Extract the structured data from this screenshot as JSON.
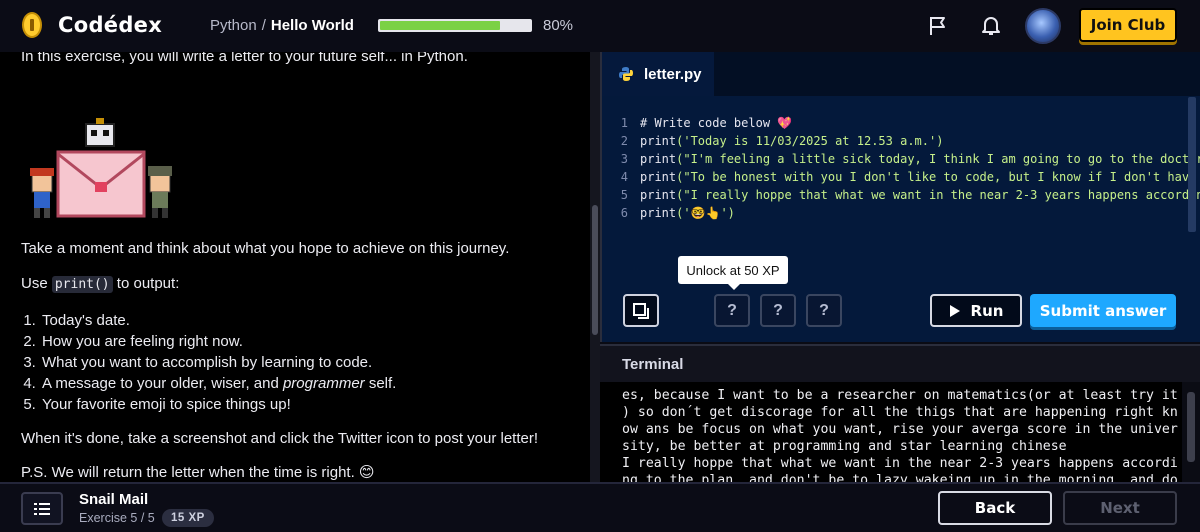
{
  "brand": {
    "name": "Codédex"
  },
  "breadcrumb": {
    "course": "Python",
    "separator": "/",
    "lesson": "Hello World"
  },
  "progress": {
    "percent": 80,
    "label": "80%"
  },
  "header": {
    "join_label": "Join Club",
    "icons": [
      "flag-icon",
      "bell-icon"
    ]
  },
  "lesson": {
    "intro": "In this exercise, you will write a letter to your future self... in Python.",
    "reflect": "Take a moment and think about what you hope to achieve on this journey.",
    "use_prefix": "Use ",
    "use_code": "print()",
    "use_suffix": " to output:",
    "steps": [
      "Today's date.",
      "How you are feeling right now.",
      "What you want to accomplish by learning to code.",
      "A message to your older, wiser, and ",
      "Your favorite emoji to spice things up!"
    ],
    "step4_em": "programmer",
    "step4_end": " self.",
    "done": "When it's done, take a screenshot and click the Twitter icon to post your letter!",
    "ps": "P.S. We will return the letter when the time is right. 😊"
  },
  "editor": {
    "tab_name": "letter.py",
    "lines": [
      {
        "n": "1",
        "pre": "",
        "text": "# Write code below 💖",
        "kind": "comment"
      },
      {
        "n": "2",
        "pre": "print",
        "text": "('Today is 11/03/2025 at 12.53 a.m.')",
        "kind": "call"
      },
      {
        "n": "3",
        "pre": "print",
        "text": "(\"I'm feeling a little sick today, I think I am going to go to the doctor",
        "kind": "call"
      },
      {
        "n": "4",
        "pre": "print",
        "text": "(\"To be honest with you I don't like to code, but I know if I don't have t",
        "kind": "call"
      },
      {
        "n": "5",
        "pre": "print",
        "text": "(\"I really hoppe that what we want in the near 2-3 years happens according",
        "kind": "call"
      },
      {
        "n": "6",
        "pre": "print",
        "text": "('🤓👆')",
        "kind": "call"
      }
    ],
    "tooltip": "Unlock at 50 XP",
    "hint_label": "?",
    "run_label": "Run",
    "submit_label": "Submit answer"
  },
  "terminal": {
    "title": "Terminal",
    "output": "es, because I want to be a researcher on matematics(or at least try it\n) so don´t get discorage for all the thigs that are happening right kn\now ans be focus on what you want, rise your averga score in the univer\nsity, be better at programming and star learning chinese\nI really hoppe that what we want in the near 2-3 years happens accordi\nng to the plan, and don't be to lazy wakeing up in the morning, and do"
  },
  "footer": {
    "exercise_title": "Snail Mail",
    "exercise_progress": "Exercise 5 / 5",
    "xp": "15 XP",
    "back_label": "Back",
    "next_label": "Next"
  },
  "colors": {
    "accent_yellow": "#ffc41f",
    "accent_blue": "#1ea8ff",
    "progress_green": "#7bd144",
    "editor_bg": "#04193b"
  }
}
